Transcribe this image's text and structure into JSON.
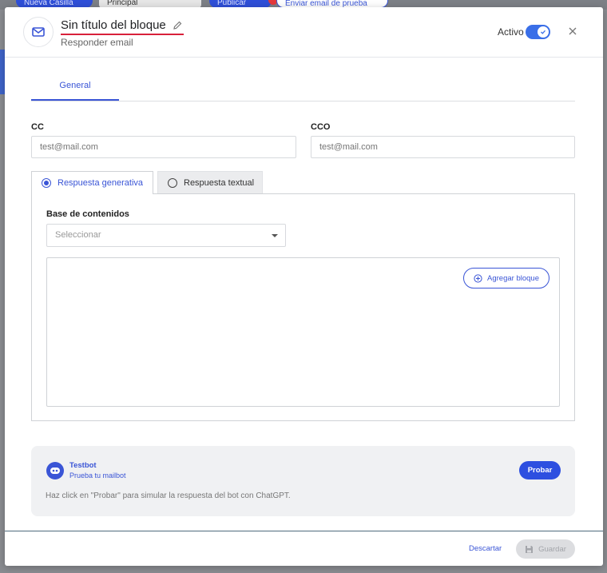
{
  "background": {
    "new_button": "Nueva Casilla",
    "select_value": "Principal",
    "publish_button": "Publicar",
    "test_email_button": "Enviar email de prueba"
  },
  "header": {
    "title": "Sin título del bloque",
    "subtitle": "Responder email",
    "active_label": "Activo",
    "active": true
  },
  "tabs": {
    "general": "General"
  },
  "form": {
    "cc_label": "CC",
    "cc_placeholder": "test@mail.com",
    "cco_label": "CCO",
    "cco_placeholder": "test@mail.com"
  },
  "response_tabs": {
    "generative": "Respuesta generativa",
    "textual": "Respuesta textual",
    "selected": "generative"
  },
  "knowledge": {
    "label": "Base de contenidos",
    "placeholder": "Seleccionar"
  },
  "editor": {
    "add_block": "Agregar bloque"
  },
  "testbot": {
    "name": "Testbot",
    "subtitle": "Prueba tu mailbot",
    "hint": "Haz click en \"Probar\" para simular la respuesta del bot con ChatGPT.",
    "try_button": "Probar"
  },
  "footer": {
    "discard": "Descartar",
    "save": "Guardar"
  },
  "colors": {
    "accent": "#3a55d6",
    "title_underline": "#d8203a",
    "toggle": "#3a6fe8"
  }
}
